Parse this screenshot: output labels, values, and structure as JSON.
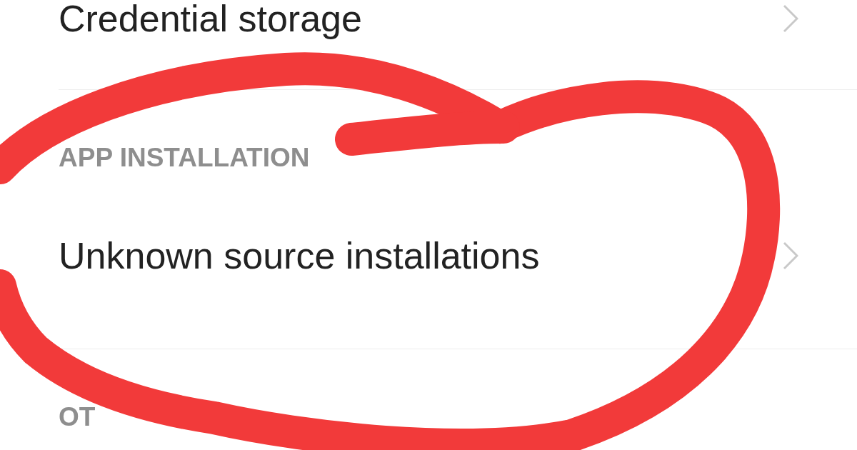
{
  "items": [
    {
      "kind": "row",
      "label": "Credential storage"
    },
    {
      "kind": "header",
      "label": "APP INSTALLATION"
    },
    {
      "kind": "row",
      "label": "Unknown source installations"
    },
    {
      "kind": "header",
      "label": "OT"
    }
  ]
}
